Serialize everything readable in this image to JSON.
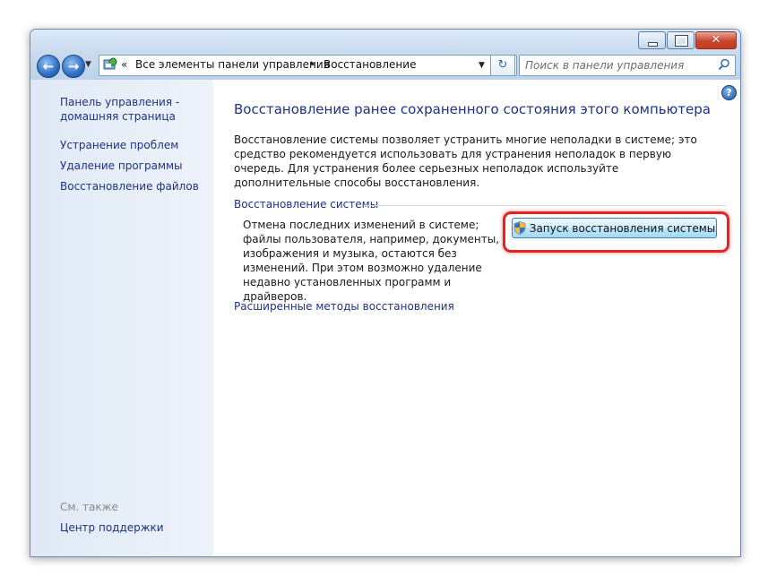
{
  "window": {
    "buttons": {
      "minimize": "minimize",
      "maximize": "maximize",
      "close": "✕"
    }
  },
  "address": {
    "chevron": "«",
    "items": [
      "Все элементы панели управления",
      "Восстановление"
    ],
    "separator": "▸"
  },
  "search": {
    "placeholder": "Поиск в панели управления"
  },
  "sidebar": {
    "home": "Панель управления -\nдомашняя страница",
    "links": [
      "Устранение проблем",
      "Удаление программы",
      "Восстановление файлов"
    ],
    "see_also": "См. также",
    "support": "Центр поддержки"
  },
  "main": {
    "help": "?",
    "title": "Восстановление ранее сохраненного состояния этого компьютера",
    "description": "Восстановление системы позволяет устранить многие неполадки в системе; это средство рекомендуется использовать для устранения неполадок в первую очередь. Для устранения более серьезных неполадок используйте дополнительные способы восстановления.",
    "section_title": "Восстановление системы",
    "section_text": "Отмена последних изменений в системе; файлы пользователя, например, документы, изображения и музыка, остаются без изменений. При этом возможно удаление недавно установленных программ и драйверов.",
    "restore_button": "Запуск восстановления системы",
    "advanced_link": "Расширенные методы восстановления"
  },
  "colors": {
    "link": "#1e3287",
    "highlight": "#e2261c",
    "sidebar": "#dfe9f5"
  },
  "icons": [
    "back-arrow-icon",
    "forward-arrow-icon",
    "control-panel-icon",
    "refresh-icon",
    "search-icon",
    "help-icon",
    "uac-shield-icon"
  ]
}
